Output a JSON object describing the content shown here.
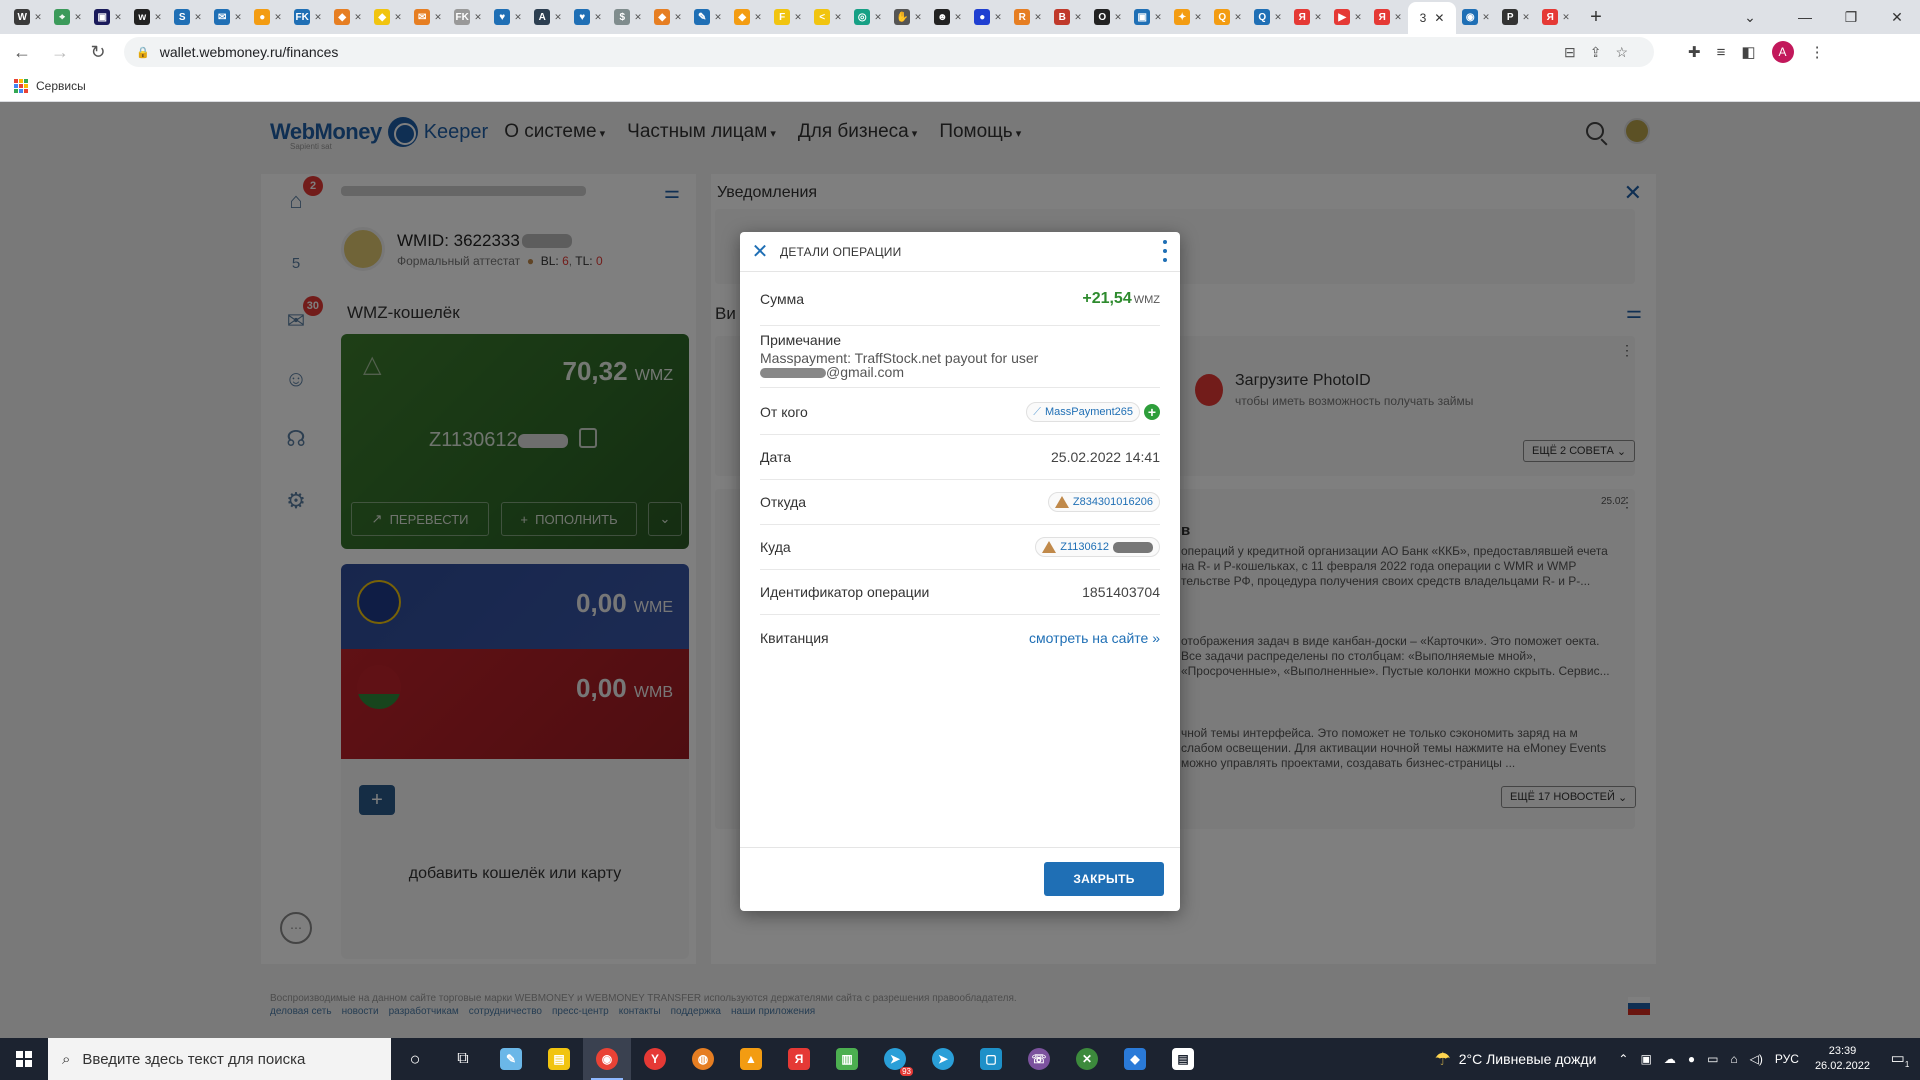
{
  "browser": {
    "tabs": [
      {
        "icon": "W",
        "color": "#3a3a3a"
      },
      {
        "icon": "⌖",
        "color": "#3b9a5a"
      },
      {
        "icon": "▣",
        "color": "#1a1a5a"
      },
      {
        "icon": "w",
        "color": "#222"
      },
      {
        "icon": "S",
        "color": "#1f6fb5"
      },
      {
        "icon": "✉",
        "color": "#1f6fb5"
      },
      {
        "icon": "●",
        "color": "#f39c12"
      },
      {
        "icon": "FK",
        "color": "#1f6fb5"
      },
      {
        "icon": "◆",
        "color": "#e67e22"
      },
      {
        "icon": "◆",
        "color": "#f1c40f"
      },
      {
        "icon": "✉",
        "color": "#e67e22"
      },
      {
        "icon": "FK",
        "color": "#999"
      },
      {
        "icon": "♥",
        "color": "#1f6fb5"
      },
      {
        "icon": "A",
        "color": "#2c3e50"
      },
      {
        "icon": "♥",
        "color": "#1f6fb5"
      },
      {
        "icon": "$",
        "color": "#7f8c8d"
      },
      {
        "icon": "◆",
        "color": "#e67e22"
      },
      {
        "icon": "✎",
        "color": "#1f6fb5"
      },
      {
        "icon": "◆",
        "color": "#f39c12"
      },
      {
        "icon": "F",
        "color": "#f1c40f"
      },
      {
        "icon": "<",
        "color": "#f1c40f"
      },
      {
        "icon": "◎",
        "color": "#16a085"
      },
      {
        "icon": "✋",
        "color": "#555"
      },
      {
        "icon": "☻",
        "color": "#222"
      },
      {
        "icon": "●",
        "color": "#1f3fd1"
      },
      {
        "icon": "R",
        "color": "#e67e22"
      },
      {
        "icon": "B",
        "color": "#c0392b"
      },
      {
        "icon": "O",
        "color": "#222"
      },
      {
        "icon": "▣",
        "color": "#1f6fb5"
      },
      {
        "icon": "✦",
        "color": "#f39c12"
      },
      {
        "icon": "Q",
        "color": "#f39c12"
      },
      {
        "icon": "Q",
        "color": "#1f6fb5"
      },
      {
        "icon": "Я",
        "color": "#e53935"
      },
      {
        "icon": "▶",
        "color": "#e53935"
      },
      {
        "icon": "Я",
        "color": "#e53935"
      }
    ],
    "active_tab": {
      "label": "3",
      "icon": "◉"
    },
    "trailing_tabs": [
      {
        "icon": "◉",
        "color": "#1f6fb5"
      },
      {
        "icon": "P",
        "color": "#333"
      },
      {
        "icon": "Я",
        "color": "#e53935"
      }
    ],
    "url": "wallet.webmoney.ru/finances",
    "bookmarks_label": "Сервисы",
    "profile_initial": "A"
  },
  "site": {
    "logo": "WebMoney",
    "logo_keeper": "Keeper",
    "logo_sub": "Sapienti sat",
    "menu": [
      "О системе",
      "Частным лицам",
      "Для бизнеса",
      "Помощь"
    ]
  },
  "rail": {
    "home_badge": "2",
    "chat_badge": "30",
    "cert_level": "5"
  },
  "wallet_panel": {
    "wmid_label": "WMID: 3622333",
    "attestat": "Формальный аттестат",
    "bl_label": "BL:",
    "bl_value": "6",
    "tl_label": "TL:",
    "tl_value": "0",
    "heading": "WMZ-кошелёк",
    "wmz_amount": "70,32",
    "wmz_currency": "WMZ",
    "wmz_number": "Z1130612",
    "btn_transfer": "ПЕРЕВЕСТИ",
    "btn_topup": "ПОПОЛНИТЬ",
    "wme_amount": "0,00",
    "wme_currency": "WME",
    "wmb_amount": "0,00",
    "wmb_currency": "WMB",
    "add_wallet": "добавить кошелёк или карту"
  },
  "notifications": {
    "title": "Уведомления",
    "vid_label": "Ви",
    "photoid_title": "Загрузите PhotoID",
    "photoid_sub": "чтобы иметь возможность получать займы",
    "more_tips": "ЕЩЁ 2 СОВЕТА",
    "news_date": "25.02",
    "news_heading_fragment": "в",
    "news1": "операций у кредитной организации АО Банк «ККБ», предоставлявшей ечета на R- и P-кошельках, с 11 февраля 2022 года операции с WMR и WMP тельстве РФ, процедура получения своих средств владельцами R- и P-...",
    "news2": "отображения задач в виде канбан-доски – «Карточки». Это поможет оекта. Все задачи распределены по столбцам: «Выполняемые мной», «Просроченные», «Выполненные». Пустые колонки можно скрыть. Сервис...",
    "news3": "чной темы интерфейса. Это поможет не только сэкономить заряд на м слабом освещении. Для активации ночной темы нажмите на eMoney Events можно управлять проектами, создавать бизнес-страницы ...",
    "more_news": "ЕЩЁ 17 НОВОСТЕЙ"
  },
  "dialog": {
    "title": "ДЕТАЛИ ОПЕРАЦИИ",
    "amount_label": "Сумма",
    "amount_value": "+21,54",
    "amount_currency": "WMZ",
    "note_label": "Примечание",
    "note_line1": "Masspayment: TraffStock.net payout for user",
    "note_line2": "@gmail.com",
    "from_label": "От кого",
    "from_value": "MassPayment265",
    "date_label": "Дата",
    "date_value": "25.02.2022 14:41",
    "source_label": "Откуда",
    "source_value": "Z834301016206",
    "dest_label": "Куда",
    "dest_value": "Z1130612",
    "opid_label": "Идентификатор операции",
    "opid_value": "1851403704",
    "receipt_label": "Квитанция",
    "receipt_link": "смотреть на сайте »",
    "close_button": "ЗАКРЫТЬ"
  },
  "footer": {
    "text": "Воспроизводимые на данном сайте торговые марки WEBMONEY и WEBMONEY TRANSFER используются держателями сайта с разрешения правообладателя.",
    "links": [
      "деловая сеть",
      "новости",
      "разработчикам",
      "сотрудничество",
      "пресс-центр",
      "контакты",
      "поддержка",
      "наши приложения"
    ]
  },
  "taskbar": {
    "search_placeholder": "Введите здесь текст для поиска",
    "weather": "2°C  Ливневые дожди",
    "lang": "РУС",
    "time": "23:39",
    "date": "26.02.2022",
    "telegram_badge": "93",
    "notif_count": "1"
  }
}
